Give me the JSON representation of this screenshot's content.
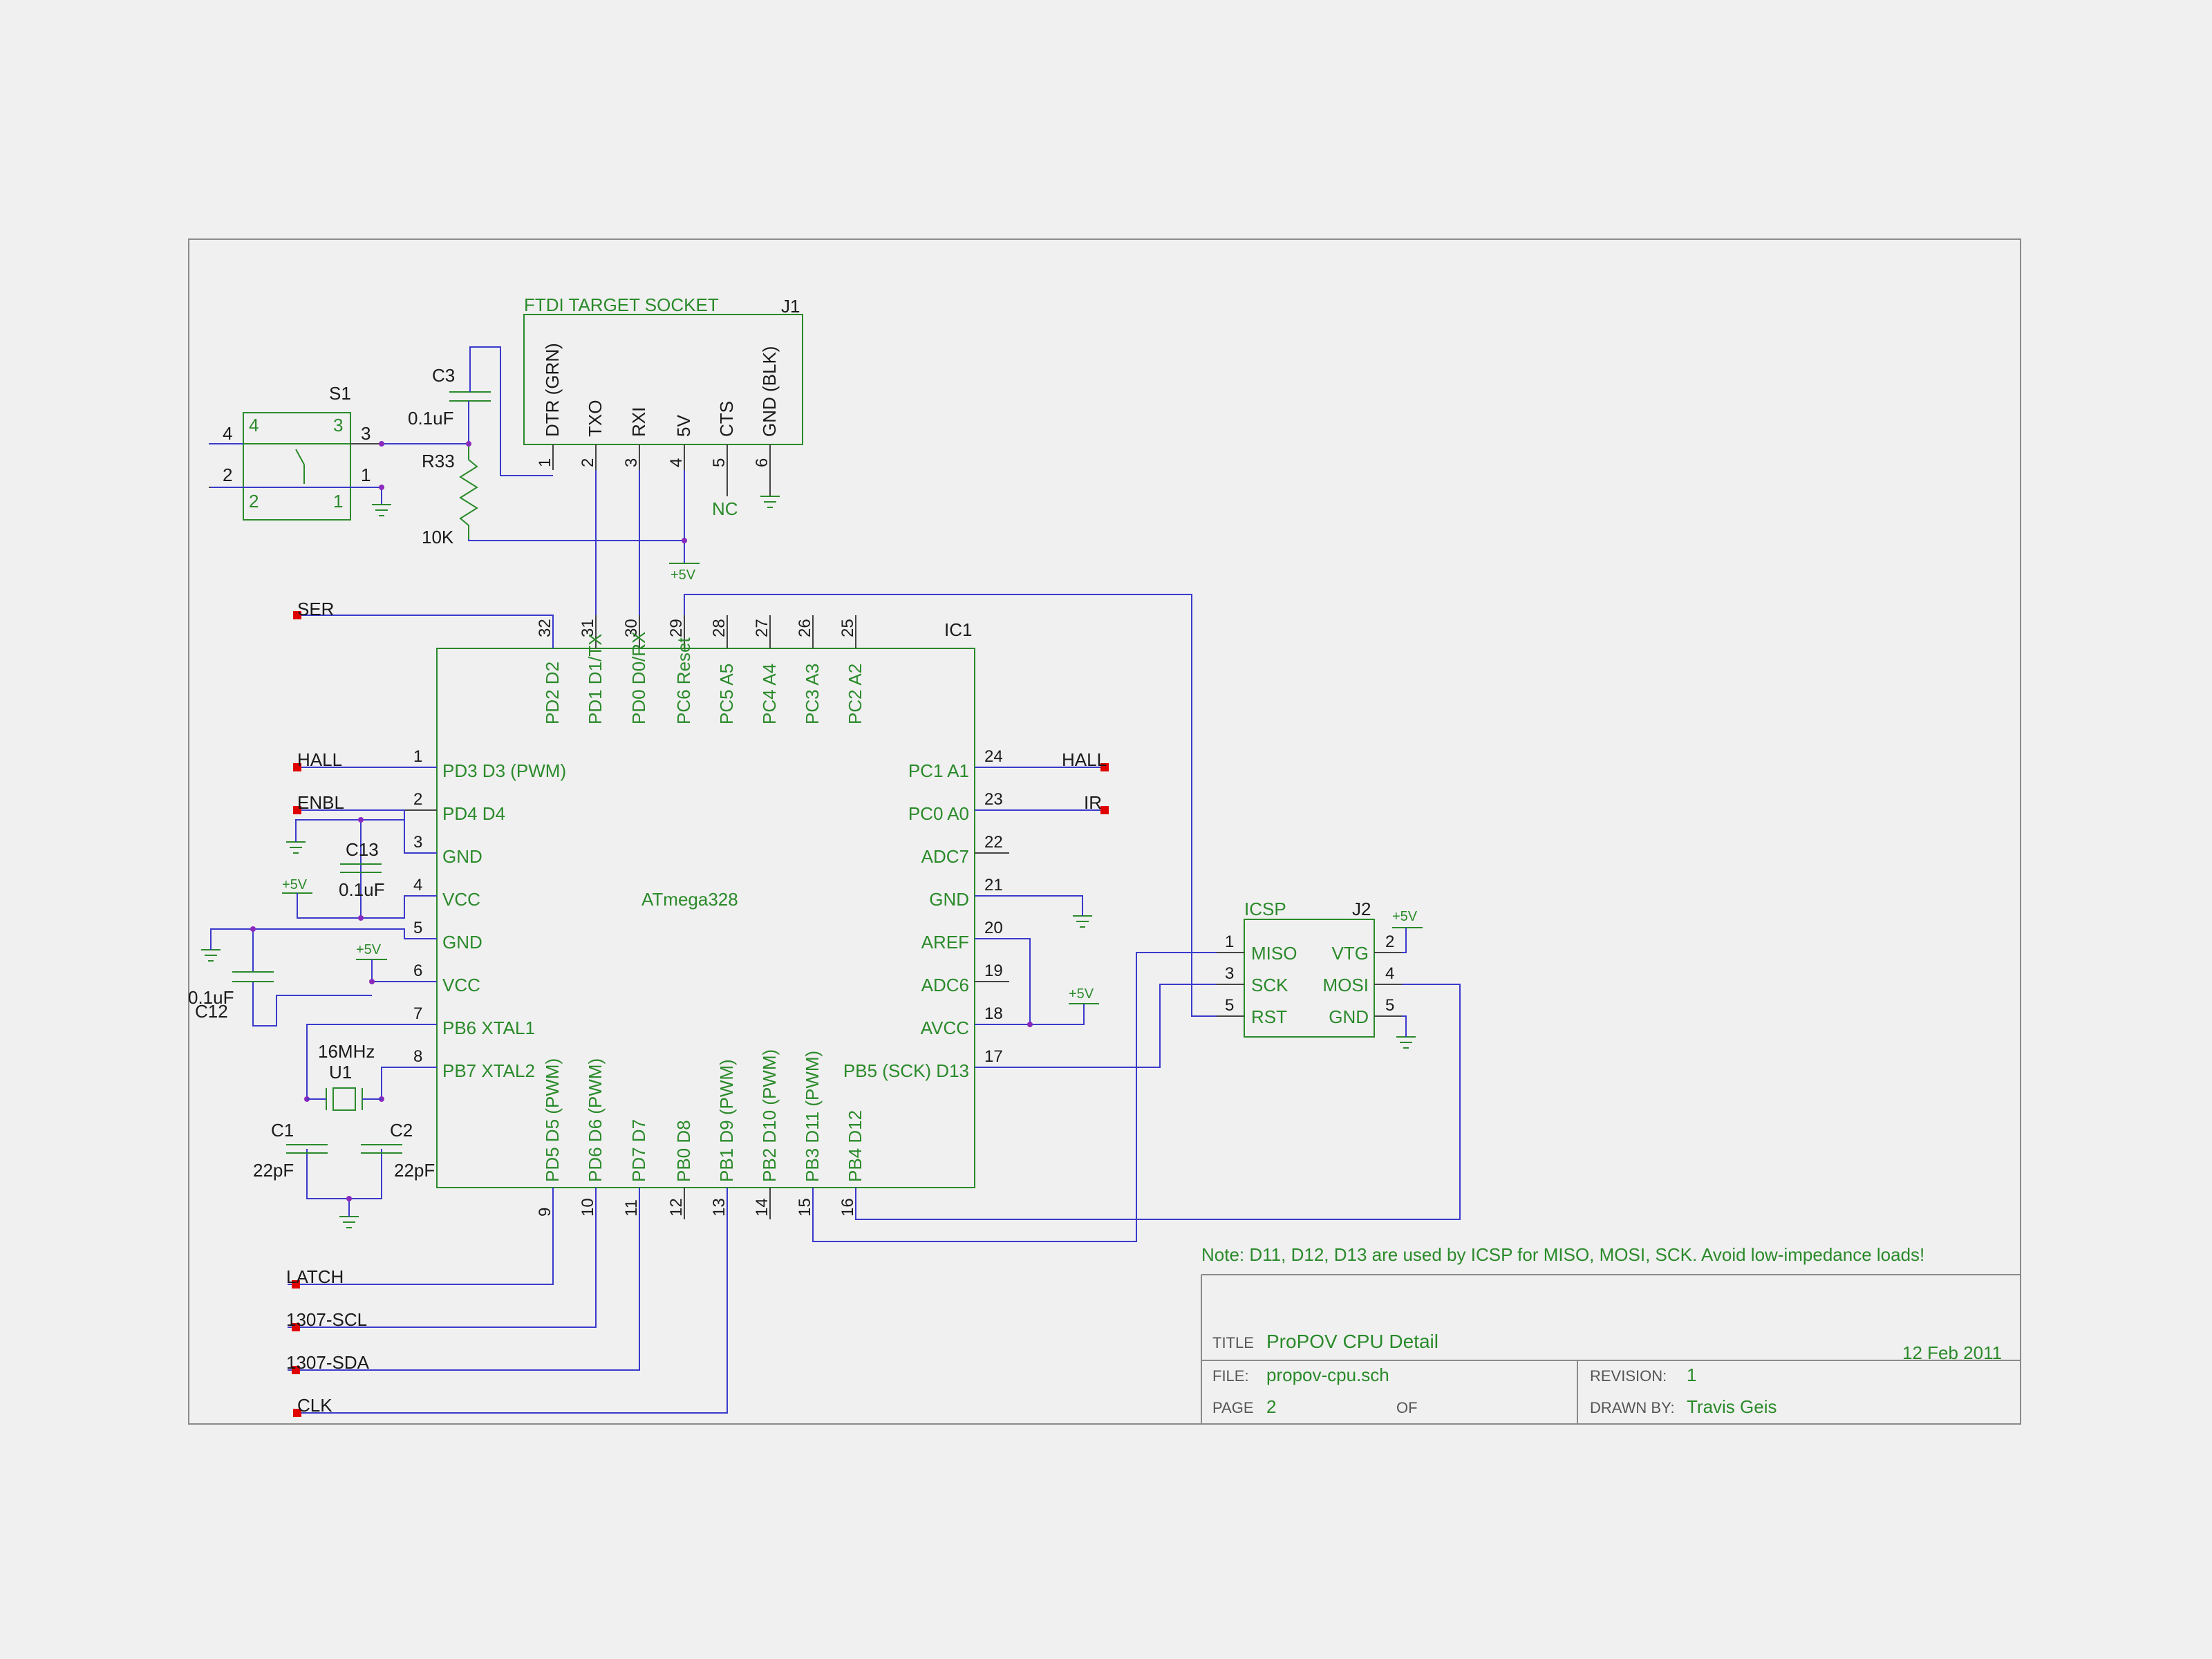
{
  "j1": {
    "title": "FTDI TARGET SOCKET",
    "ref": "J1",
    "pins": [
      {
        "name": "DTR (GRN)",
        "num": "1"
      },
      {
        "name": "TXO",
        "num": "2"
      },
      {
        "name": "RXI",
        "num": "3"
      },
      {
        "name": "5V",
        "num": "4"
      },
      {
        "name": "CTS",
        "num": "5"
      },
      {
        "name": "GND (BLK)",
        "num": "6"
      }
    ],
    "nc": "NC"
  },
  "c3": {
    "ref": "C3",
    "value": "0.1uF"
  },
  "r33": {
    "ref": "R33",
    "value": "10K"
  },
  "s1": {
    "ref": "S1",
    "outer": [
      "4",
      "3",
      "2",
      "1"
    ],
    "inner": [
      "4",
      "3",
      "2",
      "1"
    ]
  },
  "supply": "+5V",
  "ic1": {
    "ref": "IC1",
    "part": "ATmega328",
    "top_pins": [
      {
        "num": "32",
        "name": "PD2 D2"
      },
      {
        "num": "31",
        "name": "PD1 D1/TX"
      },
      {
        "num": "30",
        "name": "PD0 D0/RX"
      },
      {
        "num": "29",
        "name": "PC6 Reset"
      },
      {
        "num": "28",
        "name": "PC5 A5"
      },
      {
        "num": "27",
        "name": "PC4 A4"
      },
      {
        "num": "26",
        "name": "PC3 A3"
      },
      {
        "num": "25",
        "name": "PC2 A2"
      }
    ],
    "left_pins": [
      {
        "num": "1",
        "name": "PD3 D3 (PWM)"
      },
      {
        "num": "2",
        "name": "PD4 D4"
      },
      {
        "num": "3",
        "name": "GND"
      },
      {
        "num": "4",
        "name": "VCC"
      },
      {
        "num": "5",
        "name": "GND"
      },
      {
        "num": "6",
        "name": "VCC"
      },
      {
        "num": "7",
        "name": "PB6 XTAL1"
      },
      {
        "num": "8",
        "name": "PB7 XTAL2"
      }
    ],
    "right_pins": [
      {
        "num": "24",
        "name": "PC1 A1"
      },
      {
        "num": "23",
        "name": "PC0 A0"
      },
      {
        "num": "22",
        "name": "ADC7"
      },
      {
        "num": "21",
        "name": "GND"
      },
      {
        "num": "20",
        "name": "AREF"
      },
      {
        "num": "19",
        "name": "ADC6"
      },
      {
        "num": "18",
        "name": "AVCC"
      },
      {
        "num": "17",
        "name": "PB5 (SCK) D13"
      }
    ],
    "bottom_pins": [
      {
        "num": "9",
        "name": "PD5 D5 (PWM)"
      },
      {
        "num": "10",
        "name": "PD6 D6 (PWM)"
      },
      {
        "num": "11",
        "name": "PD7 D7"
      },
      {
        "num": "12",
        "name": "PB0 D8"
      },
      {
        "num": "13",
        "name": "PB1 D9 (PWM)"
      },
      {
        "num": "14",
        "name": "PB2 D10 (PWM)"
      },
      {
        "num": "15",
        "name": "PB3 D11 (PWM)"
      },
      {
        "num": "16",
        "name": "PB4 D12"
      }
    ]
  },
  "nets": {
    "ser": "SER",
    "hall_left": "HALL",
    "enbl": "ENBL",
    "hall_right": "HALL",
    "ir": "IR",
    "latch": "LATCH",
    "scl": "1307-SCL",
    "sda": "1307-SDA",
    "clk": "CLK"
  },
  "c13": {
    "ref": "C13",
    "value": "0.1uF"
  },
  "c12": {
    "ref": "C12",
    "value": "0.1uF"
  },
  "u1": {
    "ref": "U1",
    "value": "16MHz"
  },
  "c1": {
    "ref": "C1",
    "value": "22pF"
  },
  "c2": {
    "ref": "C2",
    "value": "22pF"
  },
  "j2": {
    "title": "ICSP",
    "ref": "J2",
    "left": [
      {
        "num": "1",
        "name": "MISO"
      },
      {
        "num": "3",
        "name": "SCK"
      },
      {
        "num": "5",
        "name": "RST"
      }
    ],
    "right": [
      {
        "num": "2",
        "name": "VTG"
      },
      {
        "num": "4",
        "name": "MOSI"
      },
      {
        "num": "5",
        "name": "GND"
      }
    ]
  },
  "note": "Note: D11, D12, D13 are used by ICSP for MISO, MOSI, SCK. Avoid low-impedance loads!",
  "title_block": {
    "title_label": "TITLE",
    "title": "ProPOV CPU Detail",
    "date": "12 Feb 2011",
    "file_label": "FILE:",
    "file": "propov-cpu.sch",
    "revision_label": "REVISION:",
    "revision": "1",
    "page_label": "PAGE",
    "page": "2",
    "of_label": "OF",
    "drawn_label": "DRAWN BY:",
    "drawn_by": "Travis Geis"
  }
}
